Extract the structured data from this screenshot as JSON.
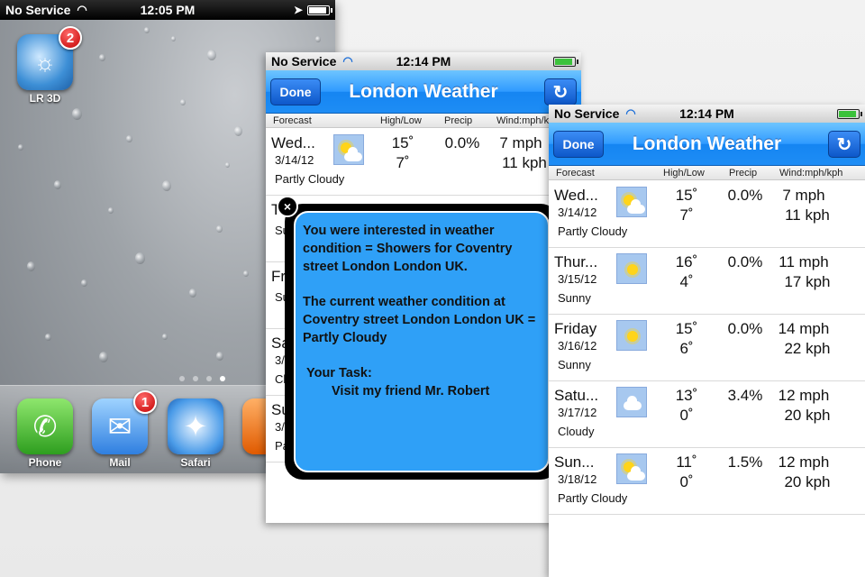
{
  "home": {
    "status": {
      "carrier": "No Service",
      "time": "12:05 PM"
    },
    "apps": [
      {
        "label": "LR 3D",
        "badge": "2",
        "icon": "weather-app-icon"
      },
      {
        "label": "Phone",
        "icon": "phone-icon"
      },
      {
        "label": "Mail",
        "badge": "1",
        "icon": "mail-icon"
      },
      {
        "label": "Safari",
        "icon": "safari-compass-icon"
      },
      {
        "label": "M",
        "icon": "partial-app-icon"
      }
    ],
    "page_count": 4,
    "active_page": 4
  },
  "weather_back": {
    "status": {
      "carrier": "No Service",
      "time": "12:14 PM"
    },
    "title": "London Weather",
    "done_label": "Done",
    "columns": [
      "Forecast",
      "High/Low",
      "Precip",
      "Wind:mph/kph"
    ],
    "rows": [
      {
        "day": "Wed...",
        "date": "3/14/12",
        "cond": "Partly Cloudy",
        "hi": "15˚",
        "lo": "7˚",
        "precip": "0.0%",
        "mph": "7 mph",
        "kph": "11 kph"
      },
      {
        "day": "Th",
        "date": "",
        "cond": "Su",
        "hi": "",
        "lo": "",
        "precip": "",
        "mph": "",
        "kph": ""
      },
      {
        "day": "Fr",
        "date": "",
        "cond": "Su",
        "hi": "",
        "lo": "",
        "precip": "",
        "mph": "",
        "kph": ""
      },
      {
        "day": "Sa",
        "date": "3/",
        "cond": "Cl",
        "hi": "",
        "lo": "",
        "precip": "",
        "mph": "",
        "kph": ""
      },
      {
        "day": "Su",
        "date": "3/",
        "cond": "Pa",
        "hi": "",
        "lo": "",
        "precip": "",
        "mph": "",
        "kph": ""
      }
    ]
  },
  "popup": {
    "line1": "You were interested in weather condition = Showers for Coventry street London London UK.",
    "line2": "The current weather condition at Coventry street London London UK = Partly Cloudy",
    "task_title": "Your Task:",
    "task_body": "Visit my friend Mr. Robert",
    "close_label": "×"
  },
  "weather_front": {
    "status": {
      "carrier": "No Service",
      "time": "12:14 PM"
    },
    "title": "London Weather",
    "done_label": "Done",
    "columns": [
      "Forecast",
      "High/Low",
      "Precip",
      "Wind:mph/kph"
    ],
    "rows": [
      {
        "day": "Wed...",
        "date": "3/14/12",
        "cond": "Partly Cloudy",
        "icon": "partly-cloudy",
        "hi": "15˚",
        "lo": "7˚",
        "precip": "0.0%",
        "mph": "7 mph",
        "kph": "11 kph"
      },
      {
        "day": "Thur...",
        "date": "3/15/12",
        "cond": "Sunny",
        "icon": "sunny",
        "hi": "16˚",
        "lo": "4˚",
        "precip": "0.0%",
        "mph": "11 mph",
        "kph": "17 kph"
      },
      {
        "day": "Friday",
        "date": "3/16/12",
        "cond": "Sunny",
        "icon": "sunny",
        "hi": "15˚",
        "lo": "6˚",
        "precip": "0.0%",
        "mph": "14 mph",
        "kph": "22 kph"
      },
      {
        "day": "Satu...",
        "date": "3/17/12",
        "cond": "Cloudy",
        "icon": "cloudy",
        "hi": "13˚",
        "lo": "0˚",
        "precip": "3.4%",
        "mph": "12 mph",
        "kph": "20 kph"
      },
      {
        "day": "Sun...",
        "date": "3/18/12",
        "cond": "Partly Cloudy",
        "icon": "partly-cloudy",
        "hi": "11˚",
        "lo": "0˚",
        "precip": "1.5%",
        "mph": "12 mph",
        "kph": "20 kph"
      }
    ]
  },
  "colors": {
    "nav_blue": "#1e8df5",
    "popup_blue": "#2fa0f7",
    "badge_red": "#c40000"
  }
}
